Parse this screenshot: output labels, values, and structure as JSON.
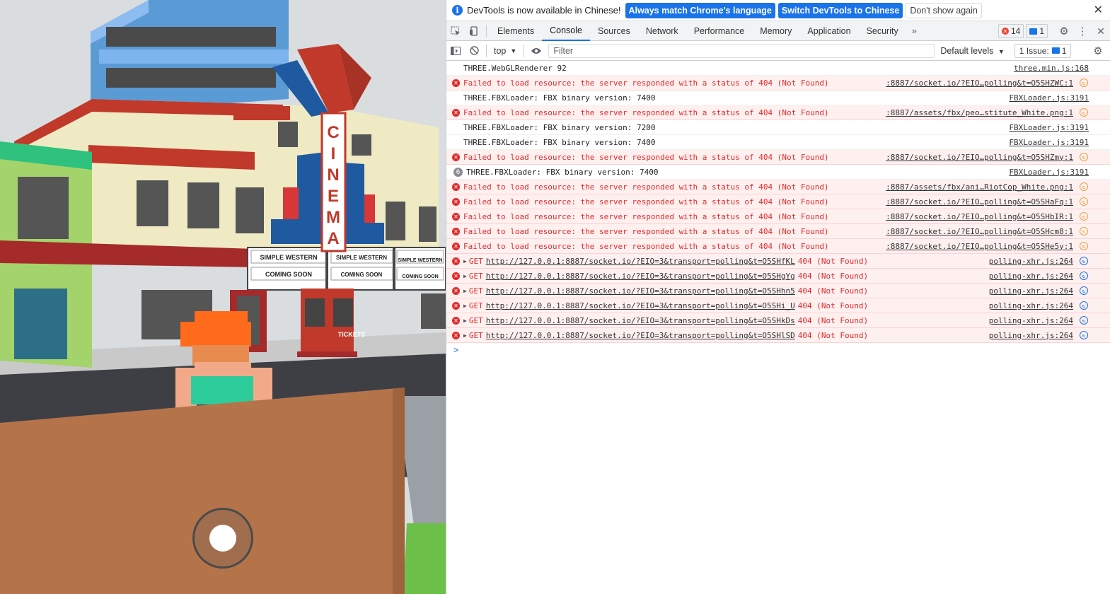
{
  "game": {
    "marquee_title_left": "SIMPLE WESTERN",
    "marquee_title_mid": "SIMPLE WESTERN",
    "marquee_title_right": "SIMPLE WESTERN",
    "marquee_sub": "COMING SOON",
    "sign_text": "CINEMA",
    "booth_text": "TICKETS"
  },
  "infobar": {
    "message": "DevTools is now available in Chinese!",
    "btn_match": "Always match Chrome's language",
    "btn_switch": "Switch DevTools to Chinese",
    "btn_dismiss": "Don't show again"
  },
  "tabs": [
    "Elements",
    "Console",
    "Sources",
    "Network",
    "Performance",
    "Memory",
    "Application",
    "Security"
  ],
  "badges": {
    "errors": "14",
    "messages": "1"
  },
  "toolbar": {
    "context": "top",
    "filter_placeholder": "Filter",
    "levels": "Default levels",
    "issues_label": "1 Issue:",
    "issues_count": "1"
  },
  "console_rows": [
    {
      "type": "log",
      "text": "THREE.WebGLRenderer 92",
      "source": "three.min.js:168"
    },
    {
      "type": "error",
      "text": "Failed to load resource: the server responded with a status of 404 (Not Found)",
      "source": ":8887/socket.io/?EIO…polling&t=O5SHZWC:1"
    },
    {
      "type": "log",
      "text": "THREE.FBXLoader: FBX binary version: 7400",
      "source": "FBXLoader.js:3191"
    },
    {
      "type": "error",
      "text": "Failed to load resource: the server responded with a status of 404 (Not Found)",
      "source": ":8887/assets/fbx/peo…stitute_White.png:1"
    },
    {
      "type": "log",
      "text": "THREE.FBXLoader: FBX binary version: 7200",
      "source": "FBXLoader.js:3191"
    },
    {
      "type": "log",
      "text": "THREE.FBXLoader: FBX binary version: 7400",
      "source": "FBXLoader.js:3191"
    },
    {
      "type": "error",
      "text": "Failed to load resource: the server responded with a status of 404 (Not Found)",
      "source": ":8887/socket.io/?EIO…polling&t=O5SHZmy:1"
    },
    {
      "type": "repeat",
      "count": "6",
      "text": "THREE.FBXLoader: FBX binary version: 7400",
      "source": "FBXLoader.js:3191"
    },
    {
      "type": "error",
      "text": "Failed to load resource: the server responded with a status of 404 (Not Found)",
      "source": ":8887/assets/fbx/ani…RiotCop_White.png:1"
    },
    {
      "type": "error",
      "text": "Failed to load resource: the server responded with a status of 404 (Not Found)",
      "source": ":8887/socket.io/?EIO…polling&t=O5SHaFq:1"
    },
    {
      "type": "error",
      "text": "Failed to load resource: the server responded with a status of 404 (Not Found)",
      "source": ":8887/socket.io/?EIO…polling&t=O5SHbIR:1"
    },
    {
      "type": "error",
      "text": "Failed to load resource: the server responded with a status of 404 (Not Found)",
      "source": ":8887/socket.io/?EIO…polling&t=O5SHcm8:1"
    },
    {
      "type": "error",
      "text": "Failed to load resource: the server responded with a status of 404 (Not Found)",
      "source": ":8887/socket.io/?EIO…polling&t=O5SHe5y:1"
    },
    {
      "type": "get",
      "method": "GET",
      "url": "http://127.0.0.1:8887/socket.io/?EIO=3&transport=polling&t=O5SHfKL",
      "status": "404 (Not Found)",
      "source": "polling-xhr.js:264"
    },
    {
      "type": "get",
      "method": "GET",
      "url": "http://127.0.0.1:8887/socket.io/?EIO=3&transport=polling&t=O5SHgYg",
      "status": "404 (Not Found)",
      "source": "polling-xhr.js:264"
    },
    {
      "type": "get",
      "method": "GET",
      "url": "http://127.0.0.1:8887/socket.io/?EIO=3&transport=polling&t=O5SHhn5",
      "status": "404 (Not Found)",
      "source": "polling-xhr.js:264"
    },
    {
      "type": "get",
      "method": "GET",
      "url": "http://127.0.0.1:8887/socket.io/?EIO=3&transport=polling&t=O5SHi_U",
      "status": "404 (Not Found)",
      "source": "polling-xhr.js:264"
    },
    {
      "type": "get",
      "method": "GET",
      "url": "http://127.0.0.1:8887/socket.io/?EIO=3&transport=polling&t=O5SHkDs",
      "status": "404 (Not Found)",
      "source": "polling-xhr.js:264"
    },
    {
      "type": "get",
      "method": "GET",
      "url": "http://127.0.0.1:8887/socket.io/?EIO=3&transport=polling&t=O5SHlSD",
      "status": "404 (Not Found)",
      "source": "polling-xhr.js:264"
    }
  ],
  "prompt": ">"
}
